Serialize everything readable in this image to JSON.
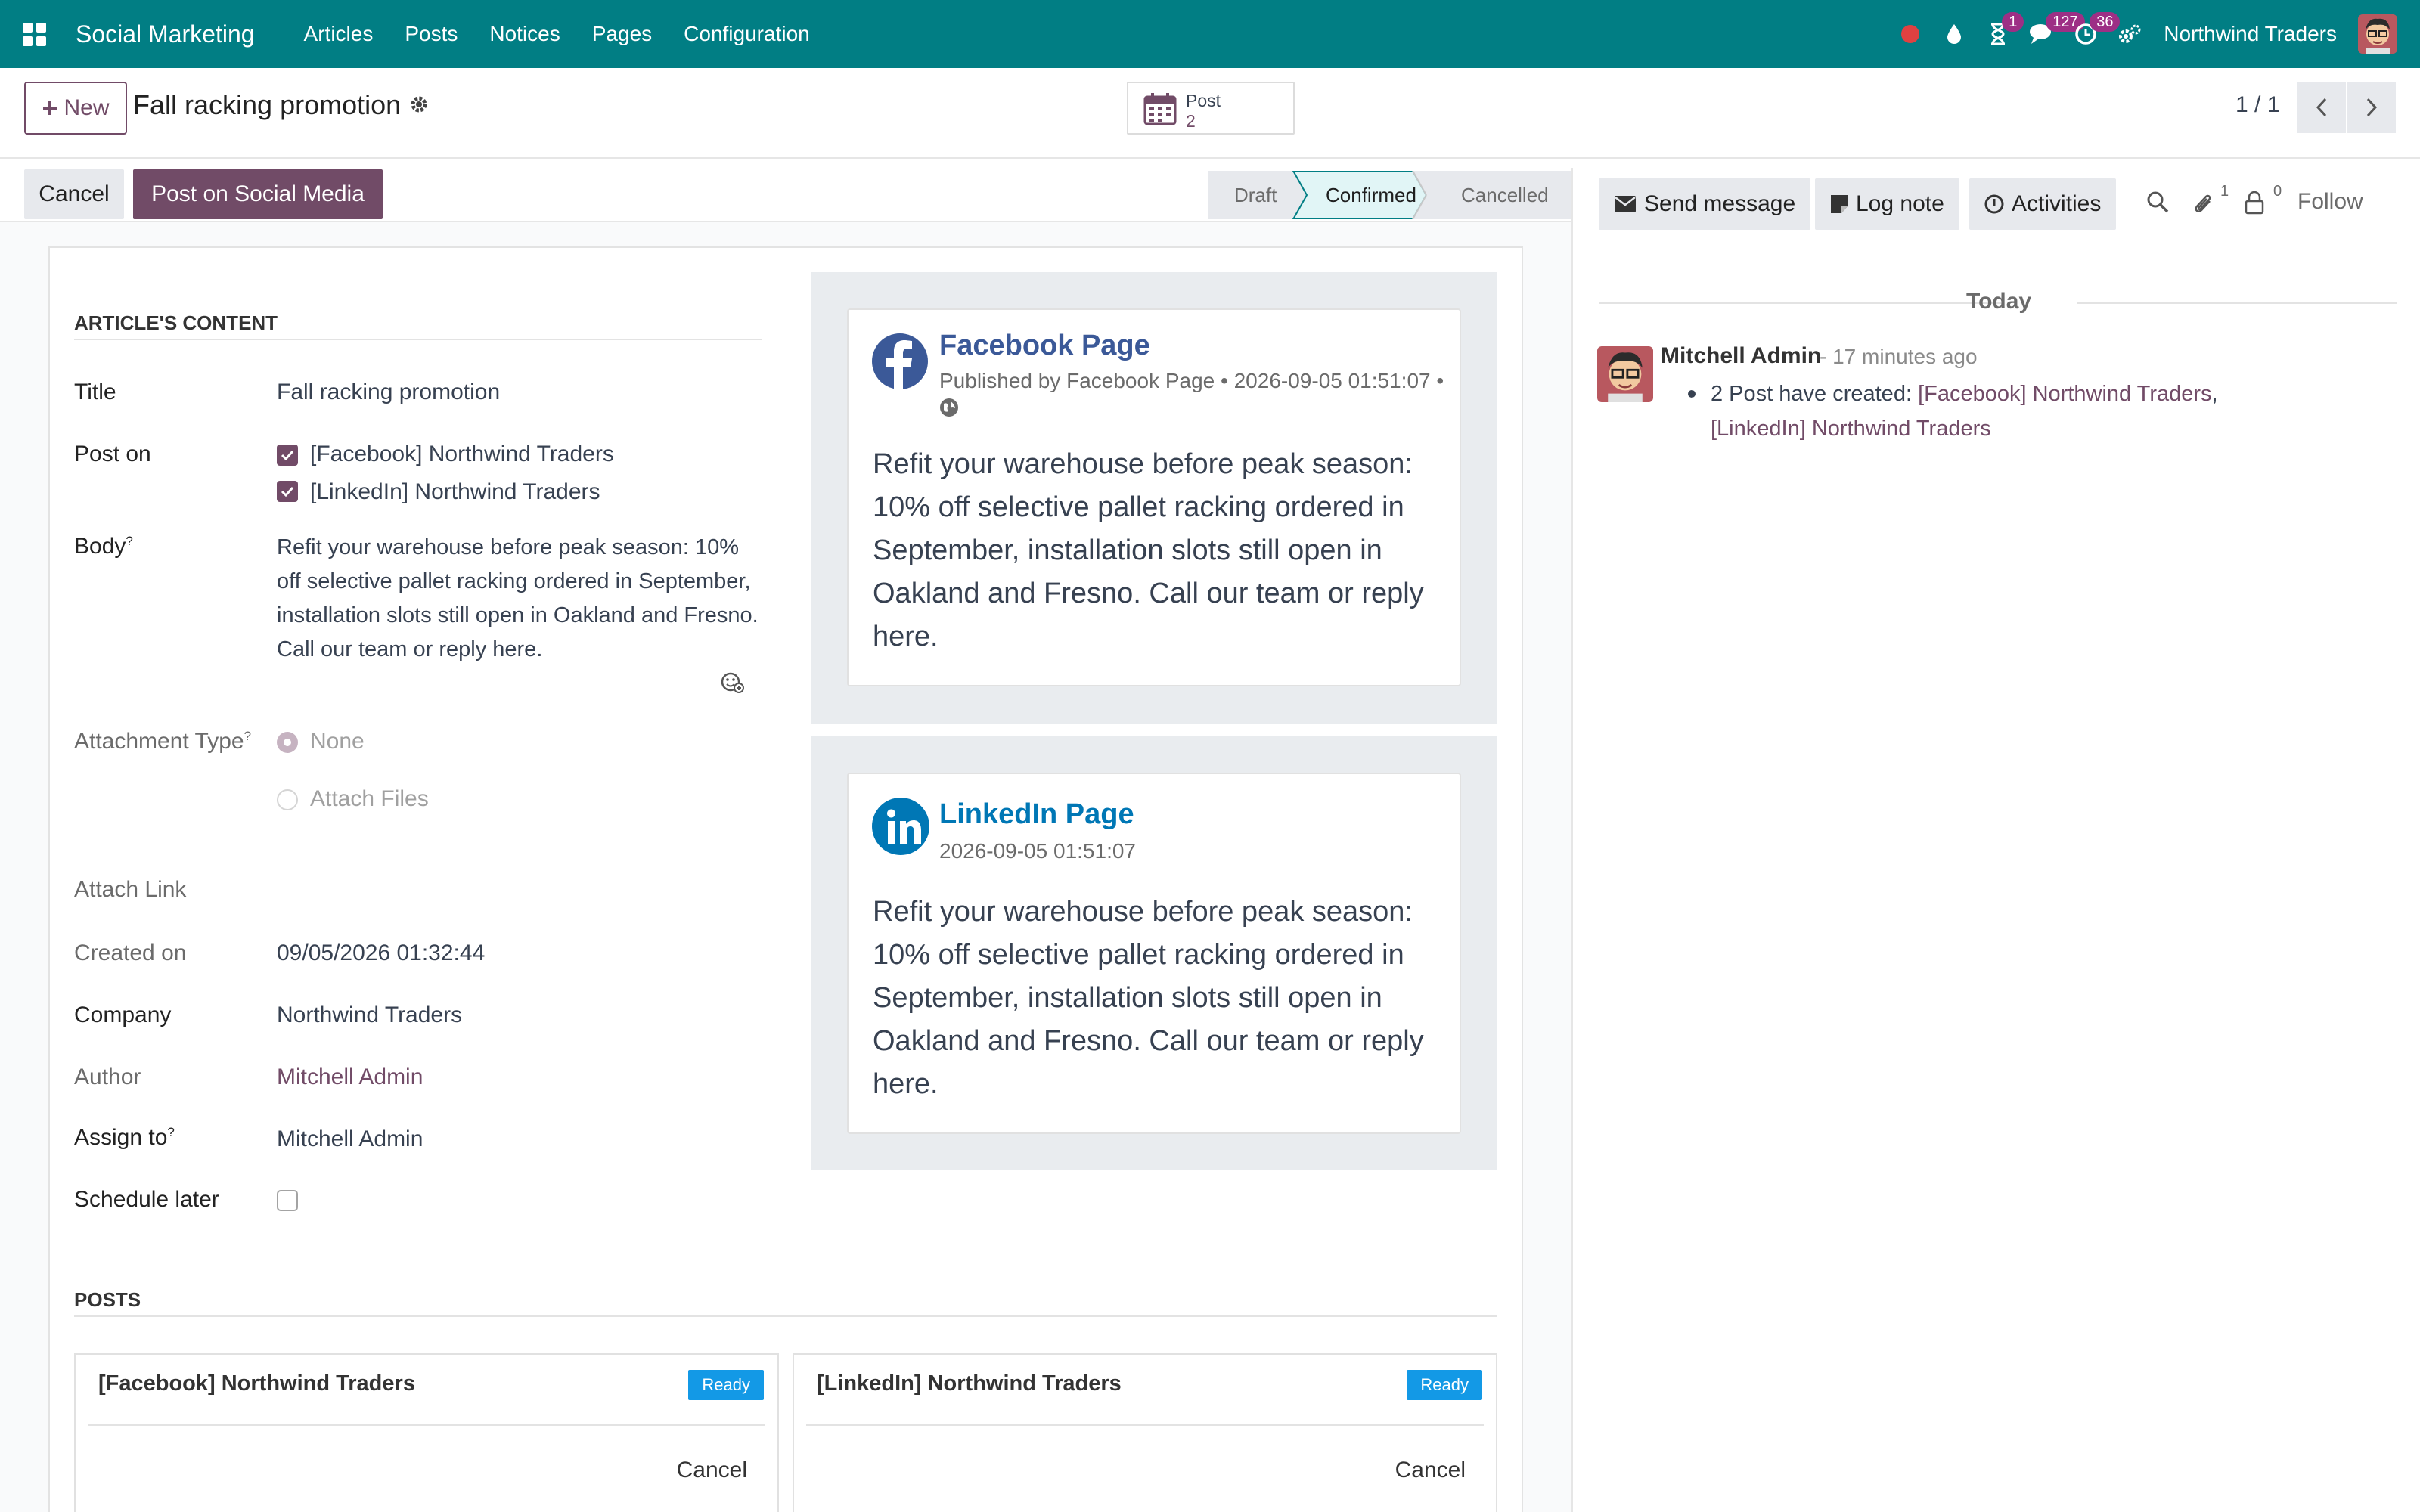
{
  "navbar": {
    "app_name": "Social Marketing",
    "menu": [
      "Articles",
      "Posts",
      "Notices",
      "Pages",
      "Configuration"
    ],
    "badges": {
      "activities_hourglass": "1",
      "messages": "127",
      "clock": "36"
    },
    "company": "Northwind Traders"
  },
  "control": {
    "new_label": "New",
    "record_title": "Fall racking promotion",
    "smart_button": {
      "label": "Post",
      "count": "2"
    },
    "pager": "1 / 1"
  },
  "statusbar": {
    "cancel_label": "Cancel",
    "post_label": "Post on Social Media",
    "stages": [
      "Draft",
      "Confirmed",
      "Cancelled"
    ],
    "active_stage": "Confirmed"
  },
  "form": {
    "section_content": "ARTICLE'S CONTENT",
    "title_label": "Title",
    "title_value": "Fall racking promotion",
    "post_on_label": "Post on",
    "post_on": [
      {
        "label": "[Facebook] Northwind Traders",
        "checked": true
      },
      {
        "label": "[LinkedIn] Northwind Traders",
        "checked": true
      }
    ],
    "body_label": "Body",
    "body_help": "?",
    "body_value": "Refit your warehouse before peak season: 10% off selective pallet racking ordered in September, installation slots still open in Oakland and Fresno. Call our team or reply here.",
    "attachment_type_label": "Attachment Type",
    "attachment_help": "?",
    "attachment_options": [
      "None",
      "Attach Files"
    ],
    "attachment_selected": "None",
    "attach_link_label": "Attach Link",
    "created_on_label": "Created on",
    "created_on_value": "09/05/2026 01:32:44",
    "company_label": "Company",
    "company_value": "Northwind Traders",
    "author_label": "Author",
    "author_value": "Mitchell Admin",
    "assign_label": "Assign to",
    "assign_help": "?",
    "assign_value": "Mitchell Admin",
    "schedule_label": "Schedule later",
    "schedule_checked": false,
    "section_posts": "POSTS"
  },
  "previews": {
    "facebook": {
      "page_name": "Facebook Page",
      "published": "Published by Facebook Page • 2026-09-05 01:51:07 •",
      "message": "Refit your warehouse before peak season: 10% off selective pallet racking ordered in September, installation slots still open in Oakland and Fresno. Call our team or reply here.",
      "color": "#3b5998"
    },
    "linkedin": {
      "page_name": "LinkedIn Page",
      "published": "2026-09-05 01:51:07",
      "message": "Refit your warehouse before peak season: 10% off selective pallet racking ordered in September, installation slots still open in Oakland and Fresno. Call our team or reply here.",
      "color": "#0077b5"
    }
  },
  "posts": [
    {
      "title": "[Facebook] Northwind Traders",
      "status": "Ready",
      "action": "Cancel"
    },
    {
      "title": "[LinkedIn] Northwind Traders",
      "status": "Ready",
      "action": "Cancel"
    }
  ],
  "chatter": {
    "send_message": "Send message",
    "log_note": "Log note",
    "activities": "Activities",
    "attachments_count": "1",
    "followers_count": "0",
    "follow": "Follow",
    "date_separator": "Today",
    "message": {
      "author": "Mitchell Admin",
      "time": "- 17 minutes ago",
      "text": "2 Post have created: ",
      "link1": "[Facebook] Northwind Traders",
      "separator": ",",
      "link2": "[LinkedIn] Northwind Traders"
    }
  },
  "colors": {
    "brand": "#017e84",
    "primary": "#714b67",
    "ready_badge": "#1399e6"
  }
}
